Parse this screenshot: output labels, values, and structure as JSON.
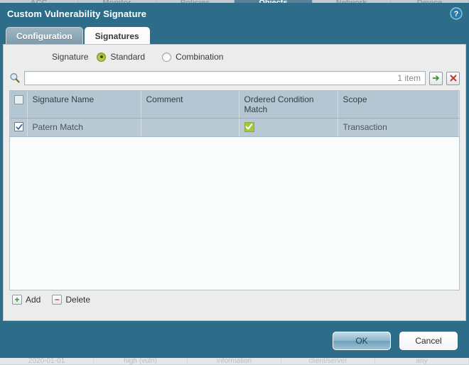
{
  "app_background": {
    "nav_items": [
      {
        "label": "ACC",
        "active": false
      },
      {
        "label": "Monitor",
        "active": false
      },
      {
        "label": "Policies",
        "active": false
      },
      {
        "label": "Objects",
        "active": true
      },
      {
        "label": "Network",
        "active": false
      },
      {
        "label": "Device",
        "active": false
      }
    ],
    "bottom_cells": [
      {
        "label": "2020-01-01"
      },
      {
        "label": "high (vuln)"
      },
      {
        "label": "information"
      },
      {
        "label": "client/server"
      },
      {
        "label": "any"
      }
    ]
  },
  "dialog": {
    "title": "Custom Vulnerability Signature",
    "help_icon": "help-circle-icon",
    "tabs": [
      {
        "label": "Configuration",
        "active": false
      },
      {
        "label": "Signatures",
        "active": true
      }
    ],
    "signature_type": {
      "label": "Signature",
      "options": [
        {
          "label": "Standard",
          "selected": true
        },
        {
          "label": "Combination",
          "selected": false
        }
      ]
    },
    "search": {
      "icon": "search-icon",
      "value": "",
      "placeholder": "",
      "item_count": "1 item",
      "apply_icon": "arrow-right-icon",
      "clear_icon": "close-x-icon"
    },
    "table": {
      "columns": [
        {
          "key": "check",
          "label": ""
        },
        {
          "key": "name",
          "label": "Signature Name"
        },
        {
          "key": "comment",
          "label": "Comment"
        },
        {
          "key": "ordered",
          "label": "Ordered Condition Match"
        },
        {
          "key": "scope",
          "label": "Scope"
        }
      ],
      "header_select_all_checked": false,
      "rows": [
        {
          "checked": true,
          "name": "Patern Match",
          "comment": "",
          "ordered_condition_match": true,
          "scope": "Transaction"
        }
      ]
    },
    "table_actions": [
      {
        "label": "Add",
        "icon": "plus-icon",
        "glyph": "+",
        "color": "#3f8f2f"
      },
      {
        "label": "Delete",
        "icon": "minus-icon",
        "glyph": "−",
        "color": "#c13a2c"
      }
    ],
    "footer_buttons": [
      {
        "label": "OK",
        "style": "primary"
      },
      {
        "label": "Cancel",
        "style": "secondary"
      }
    ]
  },
  "colors": {
    "dialog_teal": "#2e6d8a",
    "panel_gray": "#ececec",
    "table_header": "#b4c6d2",
    "table_row": "#b9cad5",
    "accent_green": "#a6c73f",
    "radio_green": "#b5c93f"
  }
}
